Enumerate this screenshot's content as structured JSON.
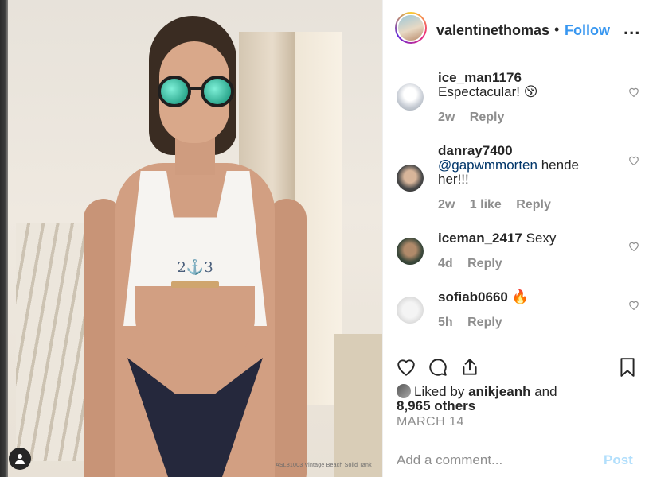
{
  "photo": {
    "caption": "ASL81003 Vintage Beach Solid Tank",
    "user_tag_icon": "user-icon",
    "logo_text": "2⚓3"
  },
  "header": {
    "username": "valentinethomas",
    "separator": "•",
    "follow_label": "Follow",
    "more_label": "...",
    "more_icon": "more-icon"
  },
  "comments": [
    {
      "username": "ice_man1176",
      "text": "Espectacular! 😚",
      "time": "2w",
      "likes": "",
      "reply": "Reply"
    },
    {
      "username": "danray7400",
      "mention": "@gapwmmorten",
      "text": "hende her!!!",
      "time": "2w",
      "likes": "1 like",
      "reply": "Reply"
    },
    {
      "username": "iceman_2417",
      "text": "Sexy",
      "time": "4d",
      "likes": "",
      "reply": "Reply"
    },
    {
      "username": "sofiab0660",
      "text": "🔥",
      "time": "5h",
      "likes": "",
      "reply": "Reply"
    }
  ],
  "actions": {
    "like_icon": "heart-icon",
    "comment_icon": "comment-icon",
    "share_icon": "share-icon",
    "save_icon": "bookmark-icon"
  },
  "likes": {
    "prefix": "Liked by",
    "user": "anikjeanh",
    "and": "and",
    "others": "8,965 others"
  },
  "date": "MARCH 14",
  "composer": {
    "placeholder": "Add a comment...",
    "post_label": "Post"
  },
  "colors": {
    "link": "#3897f0",
    "muted": "#8e8e8e",
    "post_disabled": "#b2dffc"
  }
}
